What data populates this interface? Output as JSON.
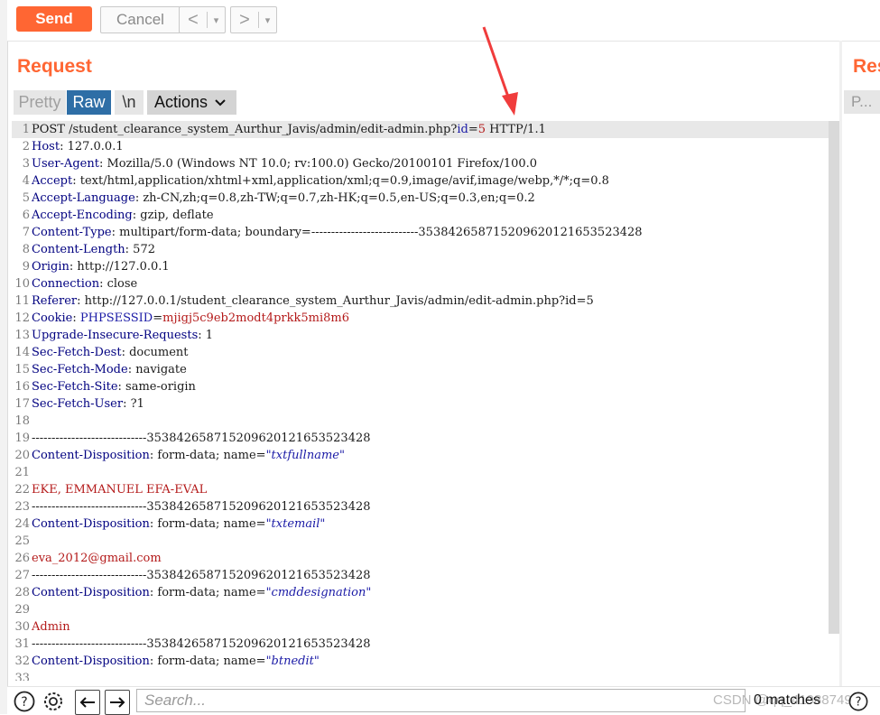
{
  "toolbar": {
    "send_label": "Send",
    "cancel_label": "Cancel",
    "back_arrow": "<",
    "forward_arrow": ">",
    "dropdown_glyph": "▾"
  },
  "request": {
    "title": "Request",
    "tabs": {
      "pretty": "Pretty",
      "raw": "Raw",
      "newline": "\\n",
      "actions": "Actions"
    }
  },
  "response": {
    "title": "Res",
    "tab": "P..."
  },
  "bottom": {
    "search_placeholder": "Search...",
    "matches": "0 matches",
    "watermark": "CSDN @qq_41988749"
  },
  "lines": [
    {
      "n": "1",
      "hl": true,
      "segs": [
        {
          "t": "POST /student_clearance_system_Aurthur_Javis/admin/edit-admin.php?"
        },
        {
          "t": "id",
          "c": "blue"
        },
        {
          "t": "="
        },
        {
          "t": "5",
          "c": "red"
        },
        {
          "t": " HTTP/1.1"
        }
      ]
    },
    {
      "n": "2",
      "segs": [
        {
          "t": "Host",
          "c": "key"
        },
        {
          "t": ": 127.0.0.1"
        }
      ]
    },
    {
      "n": "3",
      "segs": [
        {
          "t": "User-Agent",
          "c": "key"
        },
        {
          "t": ": Mozilla/5.0 (Windows NT 10.0; rv:100.0) Gecko/20100101 Firefox/100.0"
        }
      ]
    },
    {
      "n": "4",
      "segs": [
        {
          "t": "Accept",
          "c": "key"
        },
        {
          "t": ": text/html,application/xhtml+xml,application/xml;q=0.9,image/avif,image/webp,*/*;q=0.8"
        }
      ]
    },
    {
      "n": "5",
      "segs": [
        {
          "t": "Accept-Language",
          "c": "key"
        },
        {
          "t": ": zh-CN,zh;q=0.8,zh-TW;q=0.7,zh-HK;q=0.5,en-US;q=0.3,en;q=0.2"
        }
      ]
    },
    {
      "n": "6",
      "segs": [
        {
          "t": "Accept-Encoding",
          "c": "key"
        },
        {
          "t": ": gzip, deflate"
        }
      ]
    },
    {
      "n": "7",
      "segs": [
        {
          "t": "Content-Type",
          "c": "key"
        },
        {
          "t": ": multipart/form-data; boundary=---------------------------353842658715209620121653523428"
        }
      ]
    },
    {
      "n": "8",
      "segs": [
        {
          "t": "Content-Length",
          "c": "key"
        },
        {
          "t": ": 572"
        }
      ]
    },
    {
      "n": "9",
      "segs": [
        {
          "t": "Origin",
          "c": "key"
        },
        {
          "t": ": http://127.0.0.1"
        }
      ]
    },
    {
      "n": "10",
      "segs": [
        {
          "t": "Connection",
          "c": "key"
        },
        {
          "t": ": close"
        }
      ]
    },
    {
      "n": "11",
      "segs": [
        {
          "t": "Referer",
          "c": "key"
        },
        {
          "t": ": http://127.0.0.1/student_clearance_system_Aurthur_Javis/admin/edit-admin.php?id=5"
        }
      ]
    },
    {
      "n": "12",
      "segs": [
        {
          "t": "Cookie",
          "c": "key"
        },
        {
          "t": ": "
        },
        {
          "t": "PHPSESSID",
          "c": "blue"
        },
        {
          "t": "="
        },
        {
          "t": "mjigj5c9eb2modt4prkk5mi8m6",
          "c": "red"
        }
      ]
    },
    {
      "n": "13",
      "segs": [
        {
          "t": "Upgrade-Insecure-Requests",
          "c": "key"
        },
        {
          "t": ": 1"
        }
      ]
    },
    {
      "n": "14",
      "segs": [
        {
          "t": "Sec-Fetch-Dest",
          "c": "key"
        },
        {
          "t": ": document"
        }
      ]
    },
    {
      "n": "15",
      "segs": [
        {
          "t": "Sec-Fetch-Mode",
          "c": "key"
        },
        {
          "t": ": navigate"
        }
      ]
    },
    {
      "n": "16",
      "segs": [
        {
          "t": "Sec-Fetch-Site",
          "c": "key"
        },
        {
          "t": ": same-origin"
        }
      ]
    },
    {
      "n": "17",
      "segs": [
        {
          "t": "Sec-Fetch-User",
          "c": "key"
        },
        {
          "t": ": ?1"
        }
      ]
    },
    {
      "n": "18",
      "segs": []
    },
    {
      "n": "19",
      "segs": [
        {
          "t": "-----------------------------353842658715209620121653523428"
        }
      ]
    },
    {
      "n": "20",
      "segs": [
        {
          "t": "Content-Disposition",
          "c": "key"
        },
        {
          "t": ": form-data; name="
        },
        {
          "t": "\"txtfullname\"",
          "c": "str"
        }
      ]
    },
    {
      "n": "21",
      "segs": []
    },
    {
      "n": "22",
      "segs": [
        {
          "t": "EKE, EMMANUEL EFA-EVAL",
          "c": "red"
        }
      ]
    },
    {
      "n": "23",
      "segs": [
        {
          "t": "-----------------------------353842658715209620121653523428"
        }
      ]
    },
    {
      "n": "24",
      "segs": [
        {
          "t": "Content-Disposition",
          "c": "key"
        },
        {
          "t": ": form-data; name="
        },
        {
          "t": "\"txtemail\"",
          "c": "str"
        }
      ]
    },
    {
      "n": "25",
      "segs": []
    },
    {
      "n": "26",
      "segs": [
        {
          "t": "eva_2012@gmail.com",
          "c": "red"
        }
      ]
    },
    {
      "n": "27",
      "segs": [
        {
          "t": "-----------------------------353842658715209620121653523428"
        }
      ]
    },
    {
      "n": "28",
      "segs": [
        {
          "t": "Content-Disposition",
          "c": "key"
        },
        {
          "t": ": form-data; name="
        },
        {
          "t": "\"cmddesignation\"",
          "c": "str"
        }
      ]
    },
    {
      "n": "29",
      "segs": []
    },
    {
      "n": "30",
      "segs": [
        {
          "t": "Admin",
          "c": "red"
        }
      ]
    },
    {
      "n": "31",
      "segs": [
        {
          "t": "-----------------------------353842658715209620121653523428"
        }
      ]
    },
    {
      "n": "32",
      "segs": [
        {
          "t": "Content-Disposition",
          "c": "key"
        },
        {
          "t": ": form-data; name="
        },
        {
          "t": "\"btnedit\"",
          "c": "str"
        }
      ]
    },
    {
      "n": "33",
      "segs": []
    }
  ]
}
